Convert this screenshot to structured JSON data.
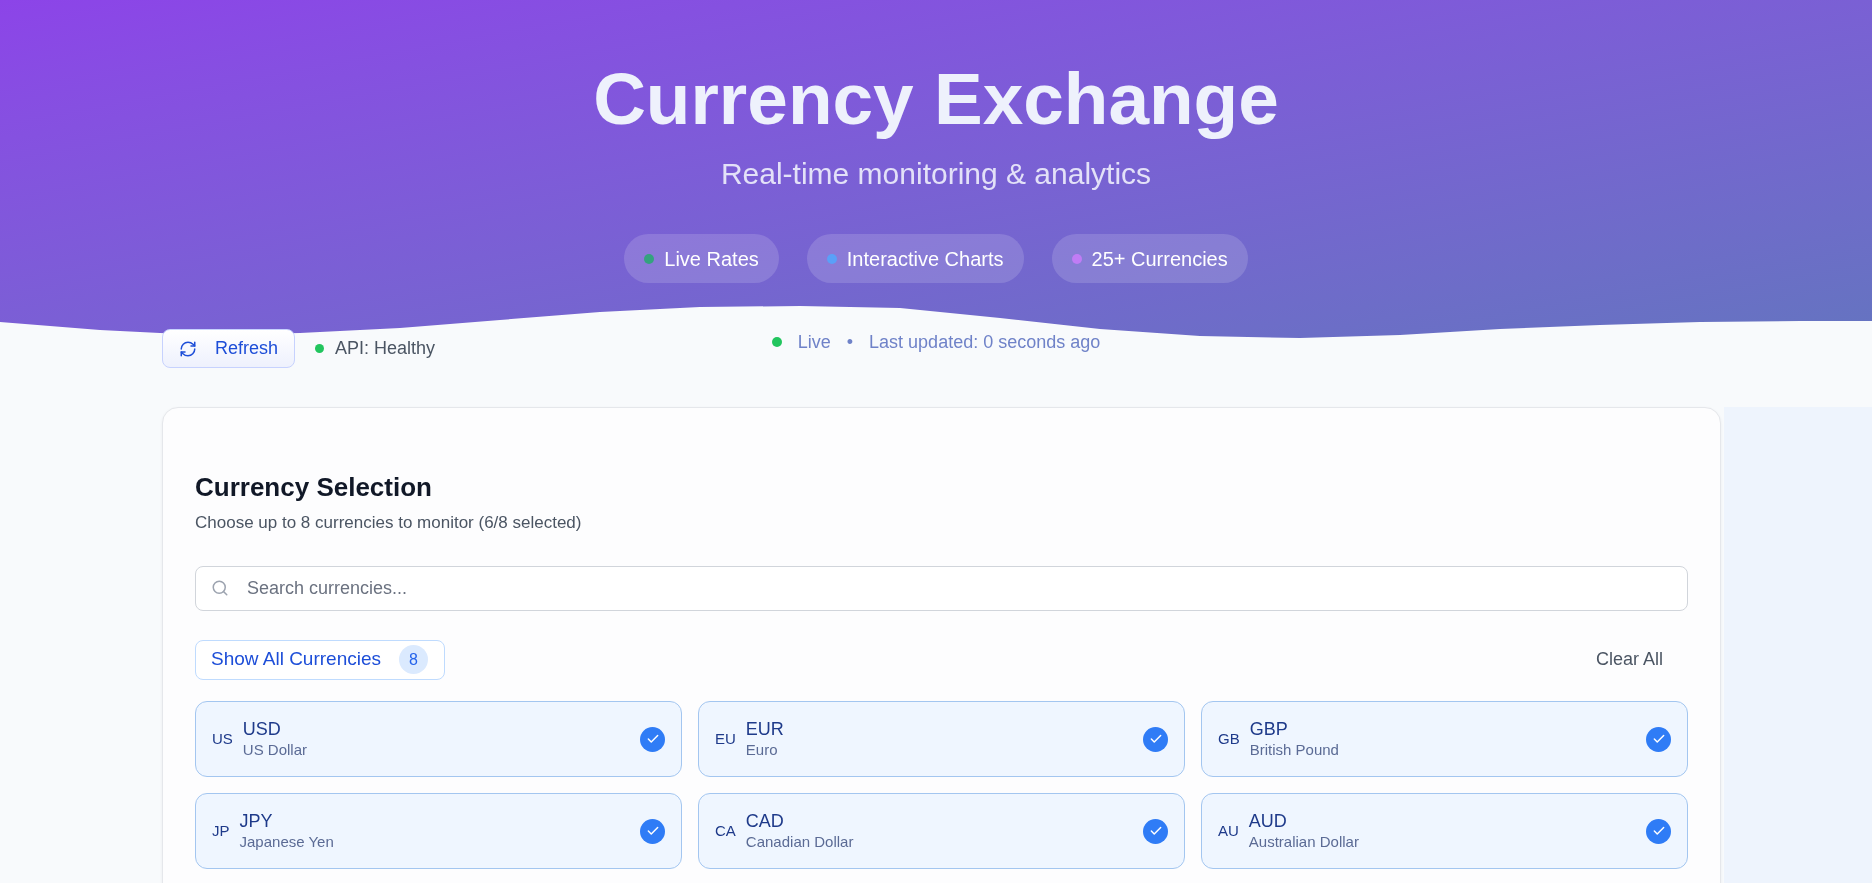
{
  "header": {
    "title": "Currency Exchange",
    "subtitle": "Real-time monitoring & analytics",
    "features": [
      {
        "label": "Live Rates",
        "color": "#34a27f"
      },
      {
        "label": "Interactive Charts",
        "color": "#5aa0f8"
      },
      {
        "label": "25+ Currencies",
        "color": "#c07cf5"
      }
    ]
  },
  "status": {
    "live_label": "Live",
    "separator": "•",
    "updated": "Last updated: 0 seconds ago"
  },
  "toolbar": {
    "refresh_button": "Refresh",
    "api_status": "API: Healthy"
  },
  "currency_selection": {
    "title": "Currency Selection",
    "description": "Choose up to 8 currencies to monitor (6/8 selected)",
    "search": {
      "placeholder": "Search currencies..."
    },
    "show_all_button": {
      "label": "Show All Currencies",
      "count": "8"
    },
    "clear_all_button": "Clear All",
    "currencies": [
      {
        "region": "US",
        "code": "USD",
        "name": "US Dollar",
        "selected": true
      },
      {
        "region": "EU",
        "code": "EUR",
        "name": "Euro",
        "selected": true
      },
      {
        "region": "GB",
        "code": "GBP",
        "name": "British Pound",
        "selected": true
      },
      {
        "region": "JP",
        "code": "JPY",
        "name": "Japanese Yen",
        "selected": true
      },
      {
        "region": "CA",
        "code": "CAD",
        "name": "Canadian Dollar",
        "selected": true
      },
      {
        "region": "AU",
        "code": "AUD",
        "name": "Australian Dollar",
        "selected": true
      }
    ]
  }
}
